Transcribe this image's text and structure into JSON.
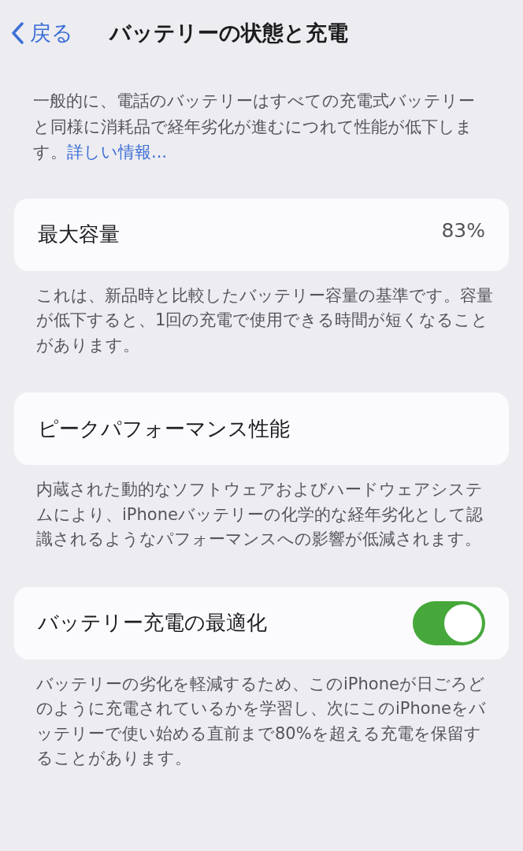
{
  "nav": {
    "back_label": "戻る",
    "title": "バッテリーの状態と充電"
  },
  "intro": {
    "text": "一般的に、電話のバッテリーはすべての充電式バッテリーと同様に消耗品で経年劣化が進むにつれて性能が低下します。",
    "link": "詳しい情報..."
  },
  "sections": [
    {
      "kind": "value",
      "label": "最大容量",
      "value": "83%",
      "footer": "これは、新品時と比較したバッテリー容量の基準です。容量が低下すると、1回の充電で使用できる時間が短くなることがあります。"
    },
    {
      "kind": "plain",
      "label": "ピークパフォーマンス性能",
      "footer": "内蔵された動的なソフトウェアおよびハードウェアシステムにより、iPhoneバッテリーの化学的な経年劣化として認識されるようなパフォーマンスへの影響が低減されます。"
    },
    {
      "kind": "toggle",
      "label": "バッテリー充電の最適化",
      "on": true,
      "footer": "バッテリーの劣化を軽減するため、このiPhoneが日ごろどのように充電されているかを学習し、次にこのiPhoneをバッテリーで使い始める直前まで80%を超える充電を保留することがあります。"
    }
  ]
}
